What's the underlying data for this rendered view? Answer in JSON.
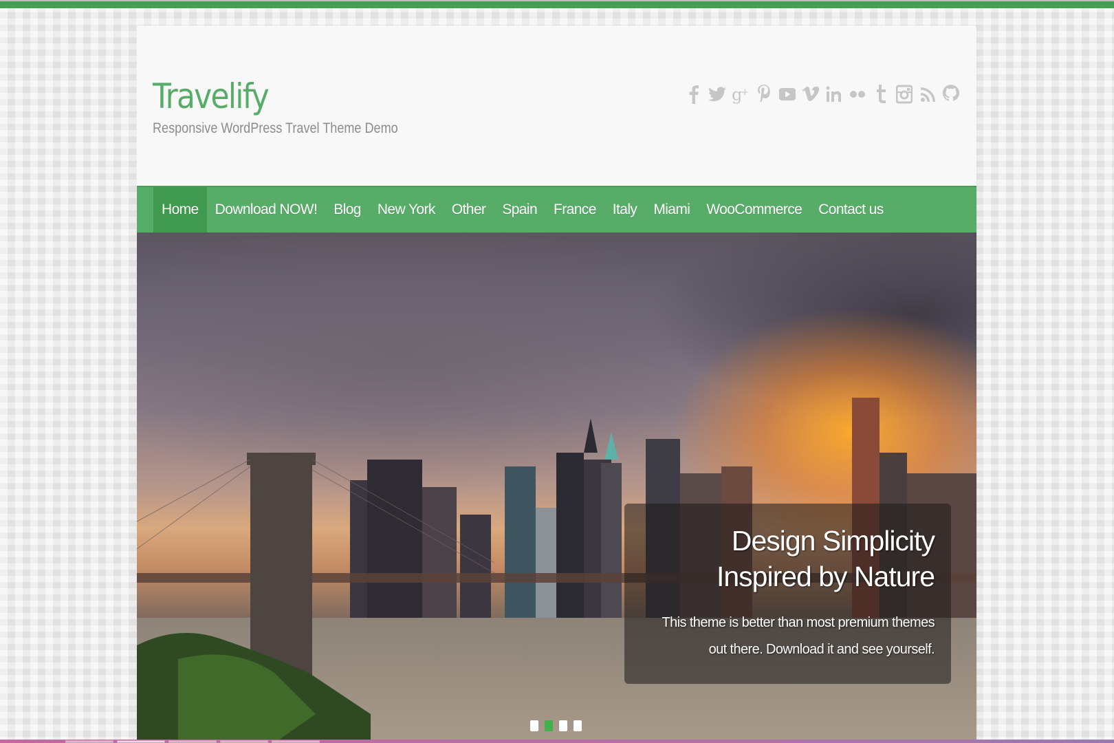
{
  "site": {
    "title": "Travelify",
    "description": "Responsive WordPress Travel Theme Demo"
  },
  "social": [
    {
      "name": "facebook",
      "glyph": "f"
    },
    {
      "name": "twitter",
      "glyph": "twitter"
    },
    {
      "name": "google-plus",
      "glyph": "g+"
    },
    {
      "name": "pinterest",
      "glyph": "p"
    },
    {
      "name": "youtube",
      "glyph": "play"
    },
    {
      "name": "vimeo",
      "glyph": "v"
    },
    {
      "name": "linkedin",
      "glyph": "in"
    },
    {
      "name": "flickr",
      "glyph": "dots"
    },
    {
      "name": "tumblr",
      "glyph": "t"
    },
    {
      "name": "instagram",
      "glyph": "camera"
    },
    {
      "name": "rss",
      "glyph": "rss"
    },
    {
      "name": "github",
      "glyph": "github"
    }
  ],
  "nav": {
    "items": [
      {
        "label": "Home",
        "active": true
      },
      {
        "label": "Download NOW!"
      },
      {
        "label": "Blog"
      },
      {
        "label": "New York"
      },
      {
        "label": "Other"
      },
      {
        "label": "Spain"
      },
      {
        "label": "France"
      },
      {
        "label": "Italy"
      },
      {
        "label": "Miami"
      },
      {
        "label": "WooCommerce"
      },
      {
        "label": "Contact us"
      }
    ]
  },
  "slider": {
    "caption_title": "Design Simplicity Inspired by Nature",
    "caption_text": "This theme is better than most premium themes out there. Download it and see yourself.",
    "slide_count": 4,
    "active_slide": 2
  },
  "colors": {
    "brand_green": "#57ad68",
    "nav_active": "#3f9a4f",
    "top_bar": "#43a051",
    "social_icon": "#c6c6c6",
    "dot_active": "#43b04f"
  }
}
